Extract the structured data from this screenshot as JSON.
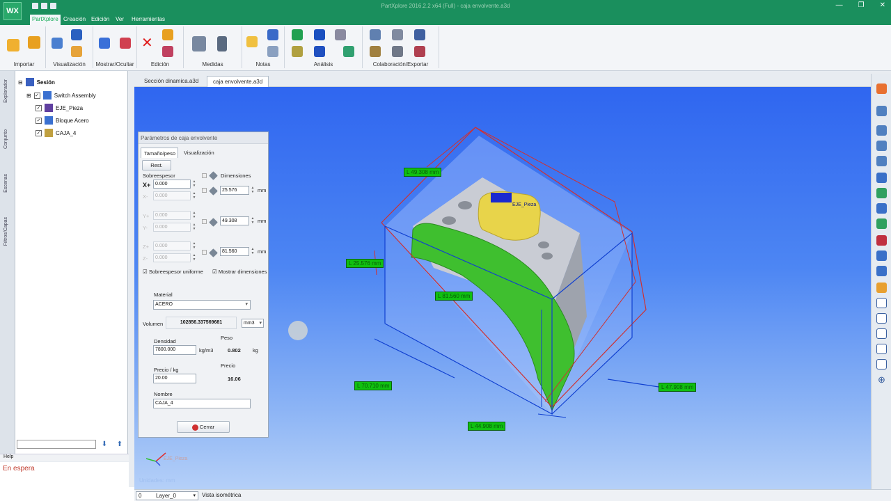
{
  "app": {
    "logo": "WX",
    "window_title": "PartXplore 2016.2.2 x64 (Full) - caja envolvente.a3d"
  },
  "menu": {
    "items": [
      "PartXplore",
      "Creación",
      "Edición",
      "Ver",
      "Herramientas"
    ]
  },
  "ribbon": {
    "groups": [
      "Importar",
      "Visualización",
      "Mostrar/Ocultar",
      "Edición",
      "Medidas",
      "Notas",
      "Análisis",
      "Colaboración/Exportar"
    ]
  },
  "side_tabs": [
    "Explorador",
    "Conjunto",
    "Escenas",
    "Filtros/Capas"
  ],
  "tree": {
    "root": "Sesión",
    "items": [
      "Switch Assembly",
      "EJE_Pieza",
      "Bloque Acero",
      "CAJA_4"
    ]
  },
  "help_label": "Help",
  "status_text": "En espera",
  "doc_tabs": [
    "Sección dinamica.a3d",
    "caja envolvente.a3d"
  ],
  "dialog": {
    "title": "Parámetros de caja envolvente",
    "tabs": [
      "Tamaño/peso",
      "Visualización"
    ],
    "reset_label": "Rest.",
    "oversize_label": "Sobreespesor",
    "dimensions_label": "Dimensiones",
    "axis_labels": [
      "X+",
      "X-",
      "Y+",
      "Y-",
      "Z+",
      "Z-"
    ],
    "oversize_values": [
      "0.000",
      "0.000",
      "0.000",
      "0.000",
      "0.000",
      "0.000"
    ],
    "dimension_values": [
      "25.576",
      "49.308",
      "81.560"
    ],
    "unit_mm": "mm",
    "uniform_label": "Sobreespesor uniforme",
    "show_dims_label": "Mostrar dimensiones",
    "material_label": "Material",
    "material_value": "ACERO",
    "volume_label": "Volumen",
    "volume_value": "102856.337569681",
    "volume_unit": "mm3",
    "density_label": "Densidad",
    "density_value": "7800.000",
    "density_unit": "kg/m3",
    "weight_label": "Peso",
    "weight_value": "0.802",
    "weight_unit": "kg",
    "price_per_kg_label": "Precio / kg",
    "price_per_kg_value": "20.00",
    "price_label": "Precio",
    "price_value": "16.06",
    "name_label": "Nombre",
    "name_value": "CAJA_4",
    "close_label": "Cerrar"
  },
  "viewport": {
    "dimension_labels": [
      "L 49.308 mm",
      "L 25.576 mm",
      "L 81.560 mm",
      "L 70.710 mm",
      "L 47.908 mm",
      "L 44.908 mm"
    ],
    "part_label": "EJE_Pieza",
    "triad_label": "EJE_Pieza",
    "units_text": "Unidades: mm"
  },
  "bottom": {
    "layer_index": "0",
    "layer_name": "Layer_0",
    "view_name": "Vista isométrica"
  },
  "colors": {
    "title_bar": "#1a8f5d",
    "viewport_top": "#2f66f0",
    "viewport_bottom": "#b5d0f8",
    "dimension_label": "#10c010",
    "part_green": "#3fbf2f",
    "part_yellow": "#f0e050",
    "box_edges_red": "#d03030",
    "box_edges_blue": "#1040d0"
  }
}
